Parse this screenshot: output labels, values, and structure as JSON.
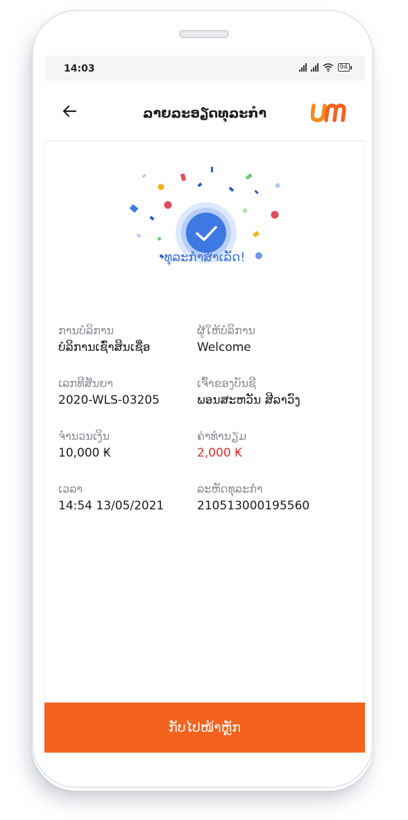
{
  "status_bar": {
    "time": "14:03",
    "battery": "94"
  },
  "header": {
    "title": "ລາຍລະອຽດທຸລະກຳ",
    "logo_text": "um"
  },
  "result": {
    "message": "ທຸລະກຳສຳເລັດ!"
  },
  "details": {
    "service_label": "ການບໍລິການ",
    "service_value": "ບໍລິການເຊົ່າສິນເຊື່ອ",
    "provider_label": "ຜູ້ໃຫ້ບໍລິການ",
    "provider_value": "Welcome",
    "contract_label": "ເລກທີສັນຍາ",
    "contract_value": "2020-WLS-03205",
    "account_owner_label": "ເຈົ້າຂອງບັນຊີ",
    "account_owner_value": "ພອນສະຫວັນ ສີລາວົງ",
    "amount_label": "ຈຳນວນເງິນ",
    "amount_value": "10,000 ₭",
    "fee_label": "ຄ່າທຳນຽມ",
    "fee_value": "2,000 ₭",
    "time_label": "ເວລາ",
    "time_value": "14:54 13/05/2021",
    "transaction_code_label": "ລະຫັດທຸລະກຳ",
    "transaction_code_value": "210513000195560"
  },
  "footer": {
    "home_button_label": "ກັບໄປໜ້າຫຼັກ"
  },
  "colors": {
    "accent": "#F5621E",
    "success_blue": "#3A6FD8",
    "fee_red": "#D9302B"
  }
}
